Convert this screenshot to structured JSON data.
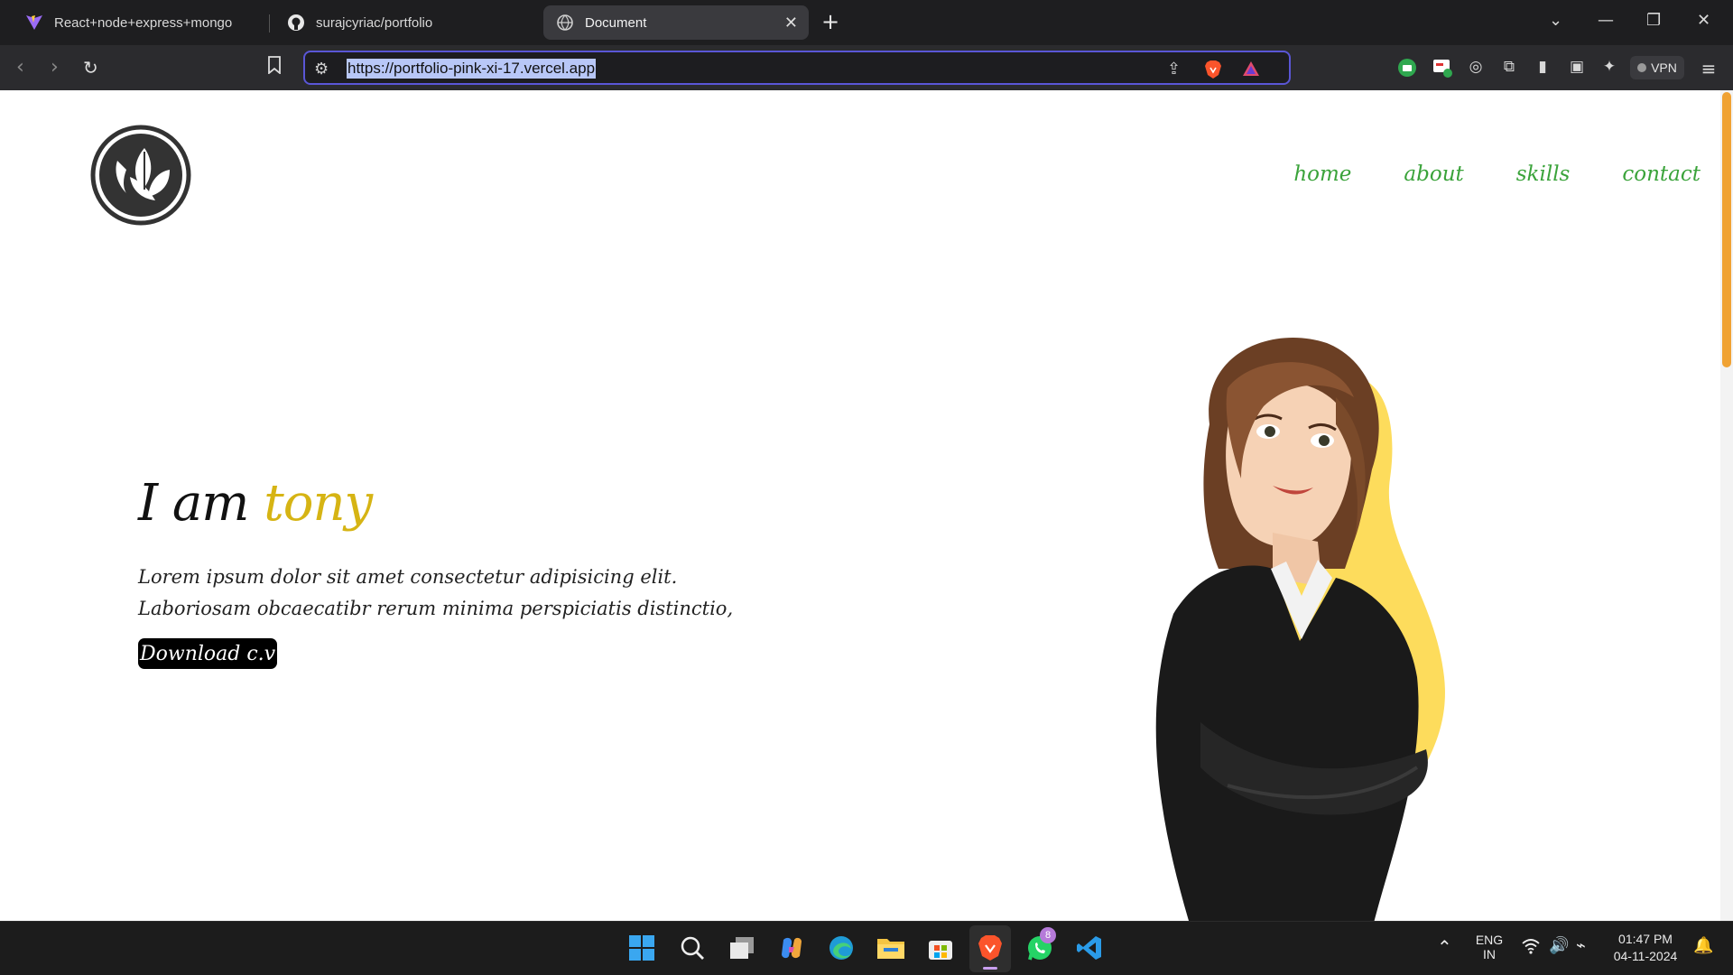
{
  "browser": {
    "tabs": [
      {
        "title": "React+node+express+mongo",
        "icon": "vite-icon"
      },
      {
        "title": "surajcyriac/portfolio",
        "icon": "github-icon"
      },
      {
        "title": "Document",
        "icon": "globe-icon",
        "active": true
      }
    ],
    "url": "https://portfolio-pink-xi-17.vercel.app",
    "vpn_label": "VPN"
  },
  "page": {
    "nav": [
      "home",
      "about",
      "skills",
      "contact"
    ],
    "hero": {
      "prefix": "I am",
      "name": "tony",
      "desc_line1": "Lorem ipsum dolor sit amet consectetur adipisicing elit.",
      "desc_line2": "Laboriosam obcaecatibr rerum minima perspiciatis distinctio,",
      "button": "Download c.v"
    },
    "colors": {
      "nav": "#3aa33a",
      "accent_name": "#d6b414",
      "blob": "#fddc5c"
    }
  },
  "taskbar": {
    "apps": [
      "windows-start",
      "search",
      "task-view",
      "copilot",
      "edge",
      "file-explorer",
      "microsoft-store",
      "brave",
      "whatsapp",
      "vscode"
    ],
    "whatsapp_badge": "8",
    "lang_line1": "ENG",
    "lang_line2": "IN",
    "time": "01:47 PM",
    "date": "04-11-2024"
  }
}
